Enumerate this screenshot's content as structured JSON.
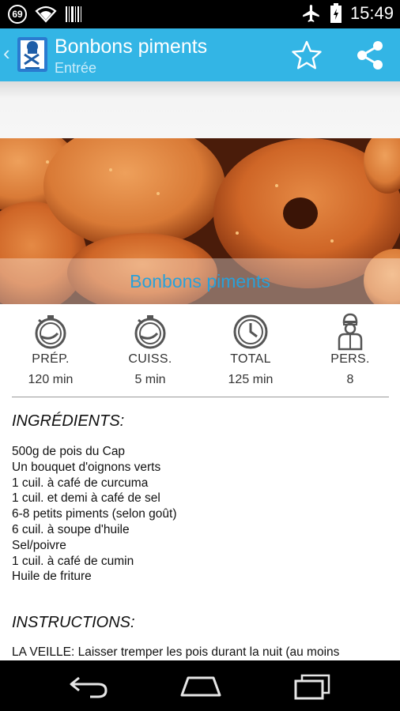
{
  "status_bar": {
    "notification_count": "69",
    "time": "15:49",
    "icons": [
      "notification-badge-icon",
      "wifi-icon",
      "barcode-icon",
      "airplane-icon",
      "battery-icon"
    ]
  },
  "app_bar": {
    "title": "Bonbons piments",
    "subtitle": "Entrée",
    "actions": [
      "star-icon",
      "share-icon"
    ],
    "color": "#33b5e5"
  },
  "hero": {
    "caption": "Bonbons piments"
  },
  "stats": [
    {
      "label": "PRÉP.",
      "value": "120 min",
      "icon": "timer-icon"
    },
    {
      "label": "CUISS.",
      "value": "5 min",
      "icon": "timer-icon"
    },
    {
      "label": "TOTAL",
      "value": "125 min",
      "icon": "clock-icon"
    },
    {
      "label": "PERS.",
      "value": "8",
      "icon": "chef-icon"
    }
  ],
  "ingredients": {
    "heading": "INGRÉDIENTS:",
    "items": [
      "500g de pois du Cap",
      "Un bouquet d'oignons verts",
      "1 cuil. à café de curcuma",
      "1 cuil. et demi à café de sel",
      "6-8 petits piments (selon goût)",
      "6 cuil. à soupe d'huile",
      "Sel/poivre",
      "1 cuil. à café de cumin",
      "Huile de friture"
    ]
  },
  "instructions": {
    "heading": "INSTRUCTIONS:",
    "text": "LA VEILLE: Laisser tremper les pois durant la nuit (au moins"
  },
  "nav_bar": {
    "buttons": [
      "back-icon",
      "home-icon",
      "recents-icon"
    ]
  }
}
